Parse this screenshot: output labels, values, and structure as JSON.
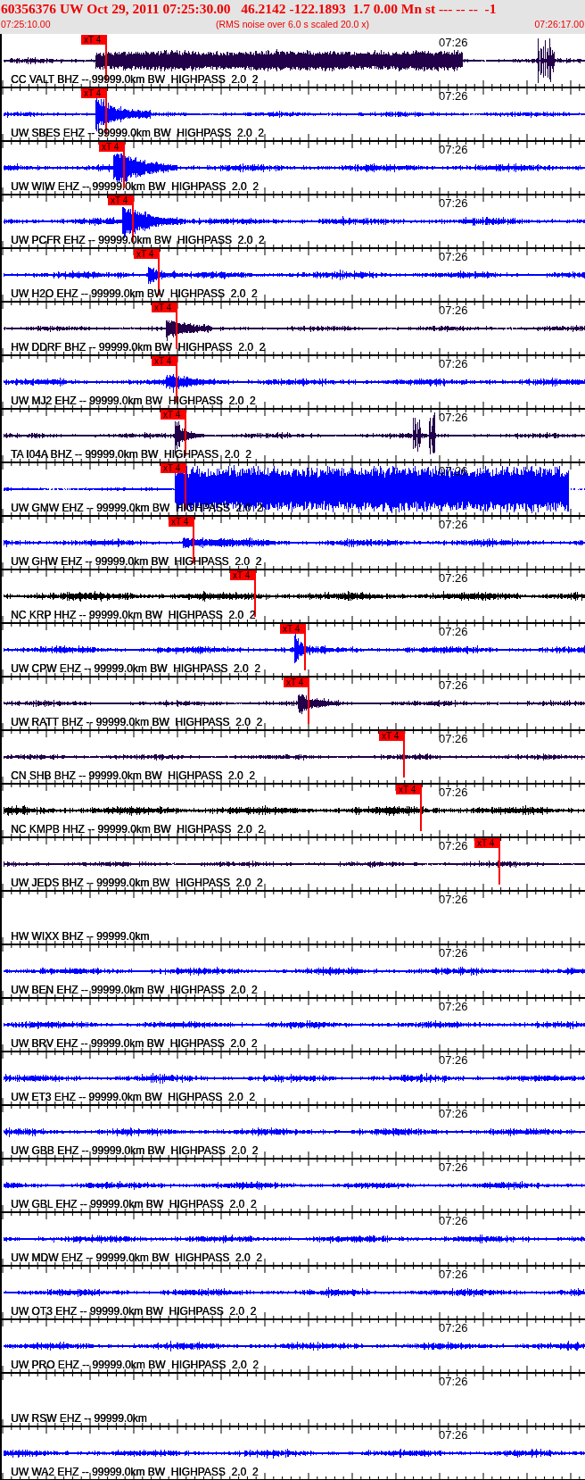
{
  "header": {
    "title": "60356376 UW Oct 29, 2011 07:25:30.00   46.2142 -122.1893  1.7 0.00 Mn st --- -- --  -1",
    "start_time": "07:25:10.00",
    "note": "(RMS noise over 6.0 s scaled 20.0 x)",
    "end_time": "07:26:17.00"
  },
  "traces": [
    {
      "label": "CC VALT BHZ -- 99999.0km BW  HIGHPASS  2.0  2",
      "time_label": "07:26",
      "color": "#22004a",
      "pick": {
        "label": "xT 4"
      }
    },
    {
      "label": "UW SBES EHZ -- 99999.0km BW  HIGHPASS  2.0  2",
      "time_label": "07:26",
      "color": "#0000ff",
      "pick": {
        "label": "xT 4"
      }
    },
    {
      "label": "UW WIW EHZ -- 99999.0km BW  HIGHPASS  2.0  2",
      "time_label": "07:26",
      "color": "#0000ff",
      "pick": {
        "label": "xT 4"
      }
    },
    {
      "label": "UW PCFR EHZ -- 99999.0km BW  HIGHPASS  2.0  2",
      "time_label": "07:26",
      "color": "#0000ff",
      "pick": {
        "label": "xT 4"
      }
    },
    {
      "label": "UW H2O EHZ -- 99999.0km BW  HIGHPASS  2.0  2",
      "time_label": "07:26",
      "color": "#0000ff",
      "pick": {
        "label": "xT 4"
      }
    },
    {
      "label": "HW DDRF BHZ -- 99999.0km BW  HIGHPASS  2.0  2",
      "time_label": "07:26",
      "color": "#22004a",
      "pick": {
        "label": "xT 4"
      }
    },
    {
      "label": "UW MJ2 EHZ -- 99999.0km BW  HIGHPASS  2.0  2",
      "time_label": "07:26",
      "color": "#0000ff",
      "pick": {
        "label": "xT 4"
      }
    },
    {
      "label": "TA I04A BHZ -- 99999.0km BW  HIGHPASS  2.0  2",
      "time_label": "07:26",
      "color": "#22004a",
      "pick": {
        "label": "xT 4"
      }
    },
    {
      "label": "UW GMW EHZ -- 99999.0km BW  HIGHPASS  2.0  2",
      "time_label": "07:26",
      "color": "#0000ff",
      "pick": {
        "label": "xT 4"
      }
    },
    {
      "label": "UW GHW EHZ -- 99999.0km BW  HIGHPASS  2.0  2",
      "time_label": "07:26",
      "color": "#0000ff",
      "pick": {
        "label": "xT 4"
      }
    },
    {
      "label": "NC KRP HHZ -- 99999.0km BW  HIGHPASS  2.0  2",
      "time_label": "07:26",
      "color": "#000000",
      "pick": {
        "label": "xT 4"
      }
    },
    {
      "label": "UW CPW EHZ -- 99999.0km BW  HIGHPASS  2.0  2",
      "time_label": "07:26",
      "color": "#0000ff",
      "pick": {
        "label": "xT 4"
      }
    },
    {
      "label": "UW RATT BHZ -- 99999.0km BW  HIGHPASS  2.0  2",
      "time_label": "07:26",
      "color": "#22004a",
      "pick": {
        "label": "xT 4"
      }
    },
    {
      "label": "CN SHB BHZ -- 99999.0km BW  HIGHPASS  2.0  2",
      "time_label": "07:26",
      "color": "#22004a",
      "pick": {
        "label": "xT 4"
      }
    },
    {
      "label": "NC KMPB HHZ -- 99999.0km BW  HIGHPASS  2.0  2",
      "time_label": "07:26",
      "color": "#000000",
      "pick": {
        "label": "xT 4"
      }
    },
    {
      "label": "UW JEDS BHZ -- 99999.0km BW  HIGHPASS  2.0  2",
      "time_label": "07:26",
      "color": "#22004a",
      "pick": {
        "label": "xT 4"
      }
    },
    {
      "label": "HW WIXX BHZ -- 99999.0km",
      "time_label": "07:26"
    },
    {
      "label": "UW BEN EHZ -- 99999.0km BW  HIGHPASS  2.0  2",
      "time_label": "07:26",
      "color": "#0000ff"
    },
    {
      "label": "UW BRV EHZ -- 99999.0km BW  HIGHPASS  2.0  2",
      "time_label": "07:26",
      "color": "#0000ff"
    },
    {
      "label": "UW ET3 EHZ -- 99999.0km BW  HIGHPASS  2.0  2",
      "time_label": "07:26",
      "color": "#0000ff"
    },
    {
      "label": "UW GBB EHZ -- 99999.0km BW  HIGHPASS  2.0  2",
      "time_label": "07:26",
      "color": "#0000ff"
    },
    {
      "label": "UW GBL EHZ -- 99999.0km BW  HIGHPASS  2.0  2",
      "time_label": "07:26",
      "color": "#0000ff"
    },
    {
      "label": "UW MDW EHZ -- 99999.0km BW  HIGHPASS  2.0  2",
      "time_label": "07:26",
      "color": "#0000ff"
    },
    {
      "label": "UW OT3 EHZ -- 99999.0km BW  HIGHPASS  2.0  2",
      "time_label": "07:26",
      "color": "#0000ff"
    },
    {
      "label": "UW PRO EHZ -- 99999.0km BW  HIGHPASS  2.0  2",
      "time_label": "07:26",
      "color": "#0000ff"
    },
    {
      "label": "UW RSW EHZ -- 99999.0km",
      "time_label": "07:26"
    },
    {
      "label": "UW WA2 EHZ -- 99999.0km BW  HIGHPASS  2.0  2",
      "time_label": "07:26",
      "color": "#0000ff"
    }
  ]
}
